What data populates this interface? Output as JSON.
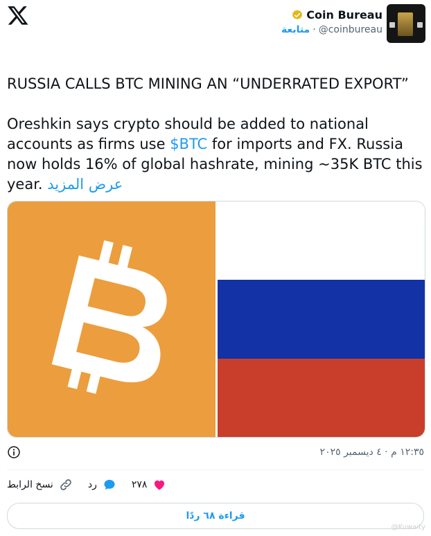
{
  "author": {
    "name": "Coin Bureau",
    "handle": "@coinbureau",
    "follow_label": "متابعة",
    "separator": "·"
  },
  "tweet": {
    "headline": "RUSSIA CALLS BTC MINING AN “UNDERRATED EXPORT”",
    "body_before": "Oreshkin says crypto should be added to national accounts as firms use ",
    "cashtag": "$BTC",
    "body_after": " for imports and FX. Russia now holds 16% of global hashrate, mining ~35K BTC this year. ",
    "show_more": "عرض المزيد"
  },
  "timestamp": "١٢:٣٥ م · ٤ ديسمبر ٢٠٢٥",
  "actions": {
    "likes": "٢٧٨",
    "reply_label": "رد",
    "copy_link_label": "نسخ الرابط"
  },
  "read_replies_label": "قراءة ٦٨ ردًا",
  "watermark": "@Kuwaity",
  "colors": {
    "accent": "#1d9bf0",
    "like": "#f91880",
    "bitcoin_orange": "#ec9d3d",
    "russia_blue": "#1232a6",
    "russia_red": "#c93e2b"
  }
}
